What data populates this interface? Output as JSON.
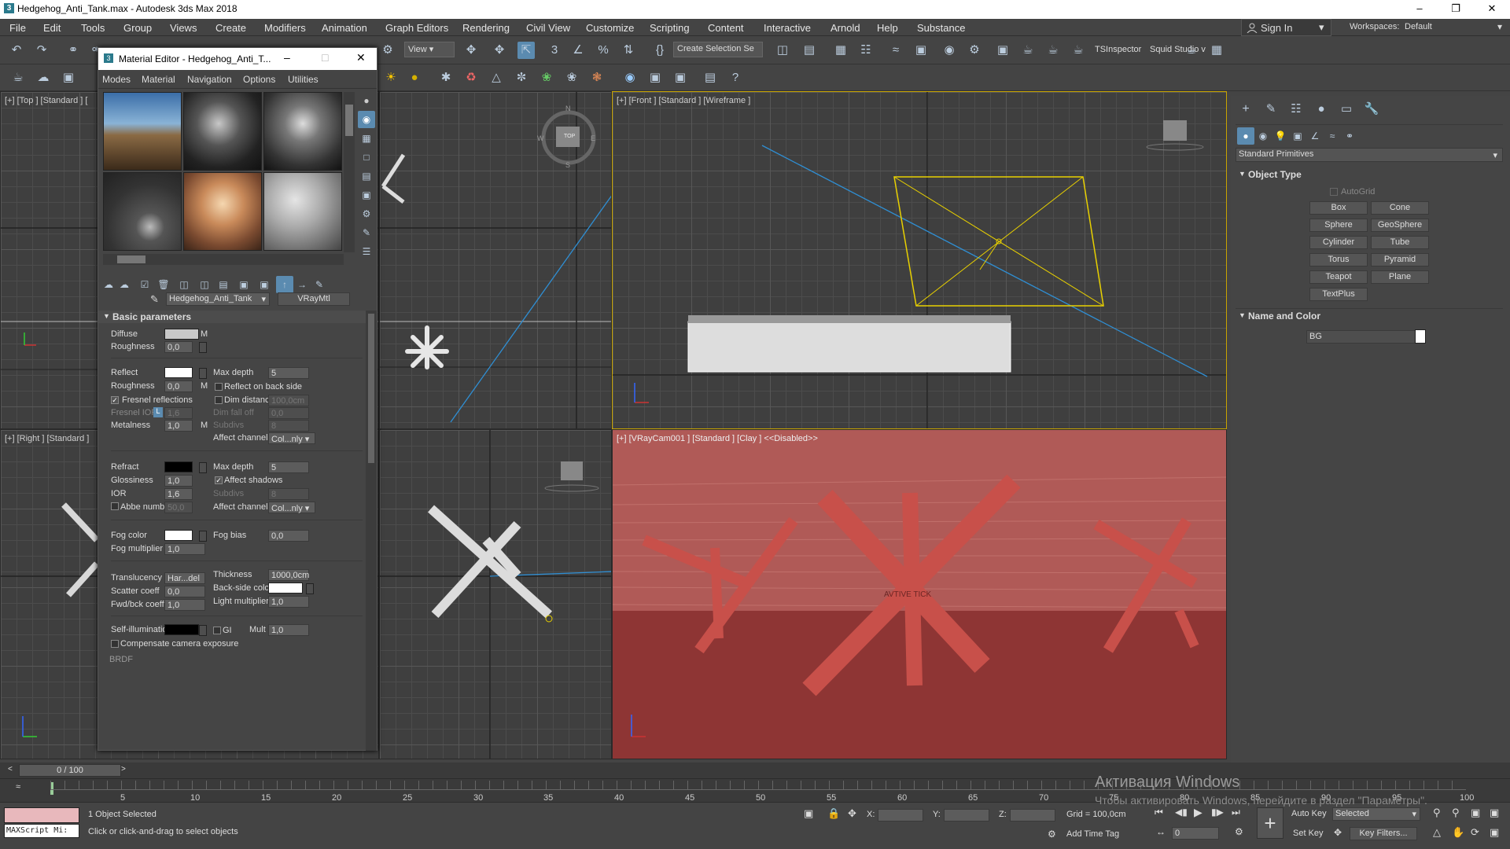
{
  "window": {
    "title": "Hedgehog_Anti_Tank.max - Autodesk 3ds Max 2018"
  },
  "menu": [
    "File",
    "Edit",
    "Tools",
    "Group",
    "Views",
    "Create",
    "Modifiers",
    "Animation",
    "Graph Editors",
    "Rendering",
    "Civil View",
    "Customize",
    "Scripting",
    "Content",
    "Interactive",
    "Arnold",
    "Help",
    "Substance"
  ],
  "signin": "Sign In",
  "workspaces": {
    "label": "Workspaces:",
    "value": "Default"
  },
  "toolbar": {
    "view_dropdown": "View",
    "selection_set": "Create Selection Se",
    "tsinspector": "TSInspector",
    "squid": "Squid Studio v"
  },
  "viewports": {
    "top": "[+] [Top ] [Standard ] [",
    "front": "[+] [Front ] [Standard ] [Wireframe ]",
    "right": "[+] [Right ] [Standard ]",
    "camera": "[+] [VRayCam001 ] [Standard ] [Clay ]  <<Disabled>>",
    "camera_text": "AVTIVE TICK"
  },
  "material_editor": {
    "title": "Material Editor - Hedgehog_Anti_T...",
    "menu": [
      "Modes",
      "Material",
      "Navigation",
      "Options",
      "Utilities"
    ],
    "material_name": "Hedgehog_Anti_Tank",
    "material_type": "VRayMtl",
    "rollout": "Basic parameters",
    "m": "M",
    "diffuse": "Diffuse",
    "roughness": "Roughness",
    "roughness_val": "0,0",
    "reflect": "Reflect",
    "refl_roughness_val": "0,0",
    "max_depth": "Max depth",
    "max_depth_val": "5",
    "reflect_back": "Reflect on back side",
    "fresnel": "Fresnel reflections",
    "dim_distance": "Dim distance",
    "dim_distance_val": "100,0cm",
    "fresnel_ior": "Fresnel IOR",
    "fresnel_l": "L",
    "fresnel_ior_val": "1,6",
    "dim_falloff": "Dim fall off",
    "dim_falloff_val": "0,0",
    "subdivs": "Subdivs",
    "subdivs_val": "8",
    "metalness": "Metalness",
    "metalness_val": "1,0",
    "affect_channels": "Affect channels",
    "affect_channels_val": "Col...nly",
    "refract": "Refract",
    "refr_max_depth_val": "5",
    "glossiness": "Glossiness",
    "glossiness_val": "1,0",
    "affect_shadows": "Affect shadows",
    "ior": "IOR",
    "ior_val": "1,6",
    "refr_subdivs_val": "8",
    "abbe": "Abbe number",
    "abbe_val": "50,0",
    "refr_affect_val": "Col...nly",
    "fog_color": "Fog color",
    "fog_bias": "Fog bias",
    "fog_bias_val": "0,0",
    "fog_mult": "Fog multiplier",
    "fog_mult_val": "1,0",
    "translucency": "Translucency",
    "translucency_val": "Har...del",
    "thickness": "Thickness",
    "thickness_val": "1000,0cm",
    "scatter": "Scatter coeff",
    "scatter_val": "0,0",
    "backside": "Back-side color",
    "fwdbck": "Fwd/bck coeff",
    "fwdbck_val": "1,0",
    "light_mult": "Light multiplier",
    "light_mult_val": "1,0",
    "self_illum": "Self-illumination",
    "gi": "GI",
    "mult": "Mult",
    "mult_val": "1,0",
    "compensate": "Compensate camera exposure",
    "next_rollout": "BRDF"
  },
  "command_panel": {
    "dropdown": "Standard Primitives",
    "object_type": "Object Type",
    "autogrid": "AutoGrid",
    "buttons": [
      "Box",
      "Cone",
      "Sphere",
      "GeoSphere",
      "Cylinder",
      "Tube",
      "Torus",
      "Pyramid",
      "Teapot",
      "Plane",
      "TextPlus"
    ],
    "name_and_color": "Name and Color",
    "name_value": "BG"
  },
  "timeline": {
    "counter": "0 / 100",
    "ticks": [
      "5",
      "10",
      "15",
      "20",
      "25",
      "30",
      "35",
      "40",
      "45",
      "50",
      "55",
      "60",
      "65",
      "70",
      "75",
      "80",
      "85",
      "90",
      "95",
      "100"
    ]
  },
  "status": {
    "maxscript": "MAXScript Mi:",
    "selected": "1 Object Selected",
    "hint": "Click or click-and-drag to select objects",
    "x": "X:",
    "y": "Y:",
    "z": "Z:",
    "grid": "Grid = 100,0cm",
    "add_time_tag": "Add Time Tag",
    "auto_key": "Auto Key",
    "selected_dropdown": "Selected",
    "set_key": "Set Key",
    "key_filters": "Key Filters...",
    "frame": "0"
  },
  "watermark": {
    "line1": "Активация Windows",
    "line2": "Чтобы активировать Windows, перейдите в раздел \"Параметры\"."
  }
}
